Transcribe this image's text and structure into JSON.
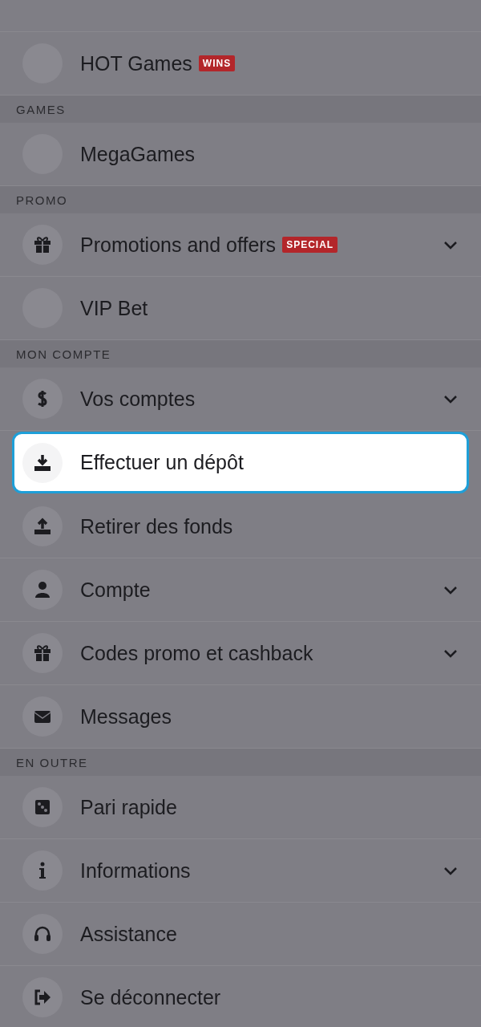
{
  "menu": [
    {
      "kind": "item",
      "label": "HOT Games",
      "badge": "WINS",
      "expandable": false,
      "selected": false
    },
    {
      "kind": "header",
      "label": "GAMES"
    },
    {
      "kind": "item",
      "label": "MegaGames",
      "expandable": false,
      "selected": false
    },
    {
      "kind": "header",
      "label": "PROMO"
    },
    {
      "kind": "item",
      "label": "Promotions and offers",
      "badge": "SPECIAL",
      "expandable": true,
      "selected": false
    },
    {
      "kind": "item",
      "label": "VIP Bet",
      "expandable": false,
      "selected": false
    },
    {
      "kind": "header",
      "label": "MON COMPTE"
    },
    {
      "kind": "item",
      "label": "Vos comptes",
      "expandable": true,
      "selected": false
    },
    {
      "kind": "item",
      "label": "Effectuer un dépôt",
      "expandable": false,
      "selected": true
    },
    {
      "kind": "item",
      "label": "Retirer des fonds",
      "expandable": false,
      "selected": false
    },
    {
      "kind": "item",
      "label": "Compte",
      "expandable": true,
      "selected": false
    },
    {
      "kind": "item",
      "label": "Codes promo et cashback",
      "expandable": true,
      "selected": false
    },
    {
      "kind": "item",
      "label": "Messages",
      "expandable": false,
      "selected": false
    },
    {
      "kind": "header",
      "label": "EN OUTRE"
    },
    {
      "kind": "item",
      "label": "Pari rapide",
      "expandable": false,
      "selected": false
    },
    {
      "kind": "item",
      "label": "Informations",
      "expandable": true,
      "selected": false
    },
    {
      "kind": "item",
      "label": "Assistance",
      "expandable": false,
      "selected": false
    },
    {
      "kind": "item",
      "label": "Se déconnecter",
      "expandable": false,
      "selected": false
    }
  ]
}
